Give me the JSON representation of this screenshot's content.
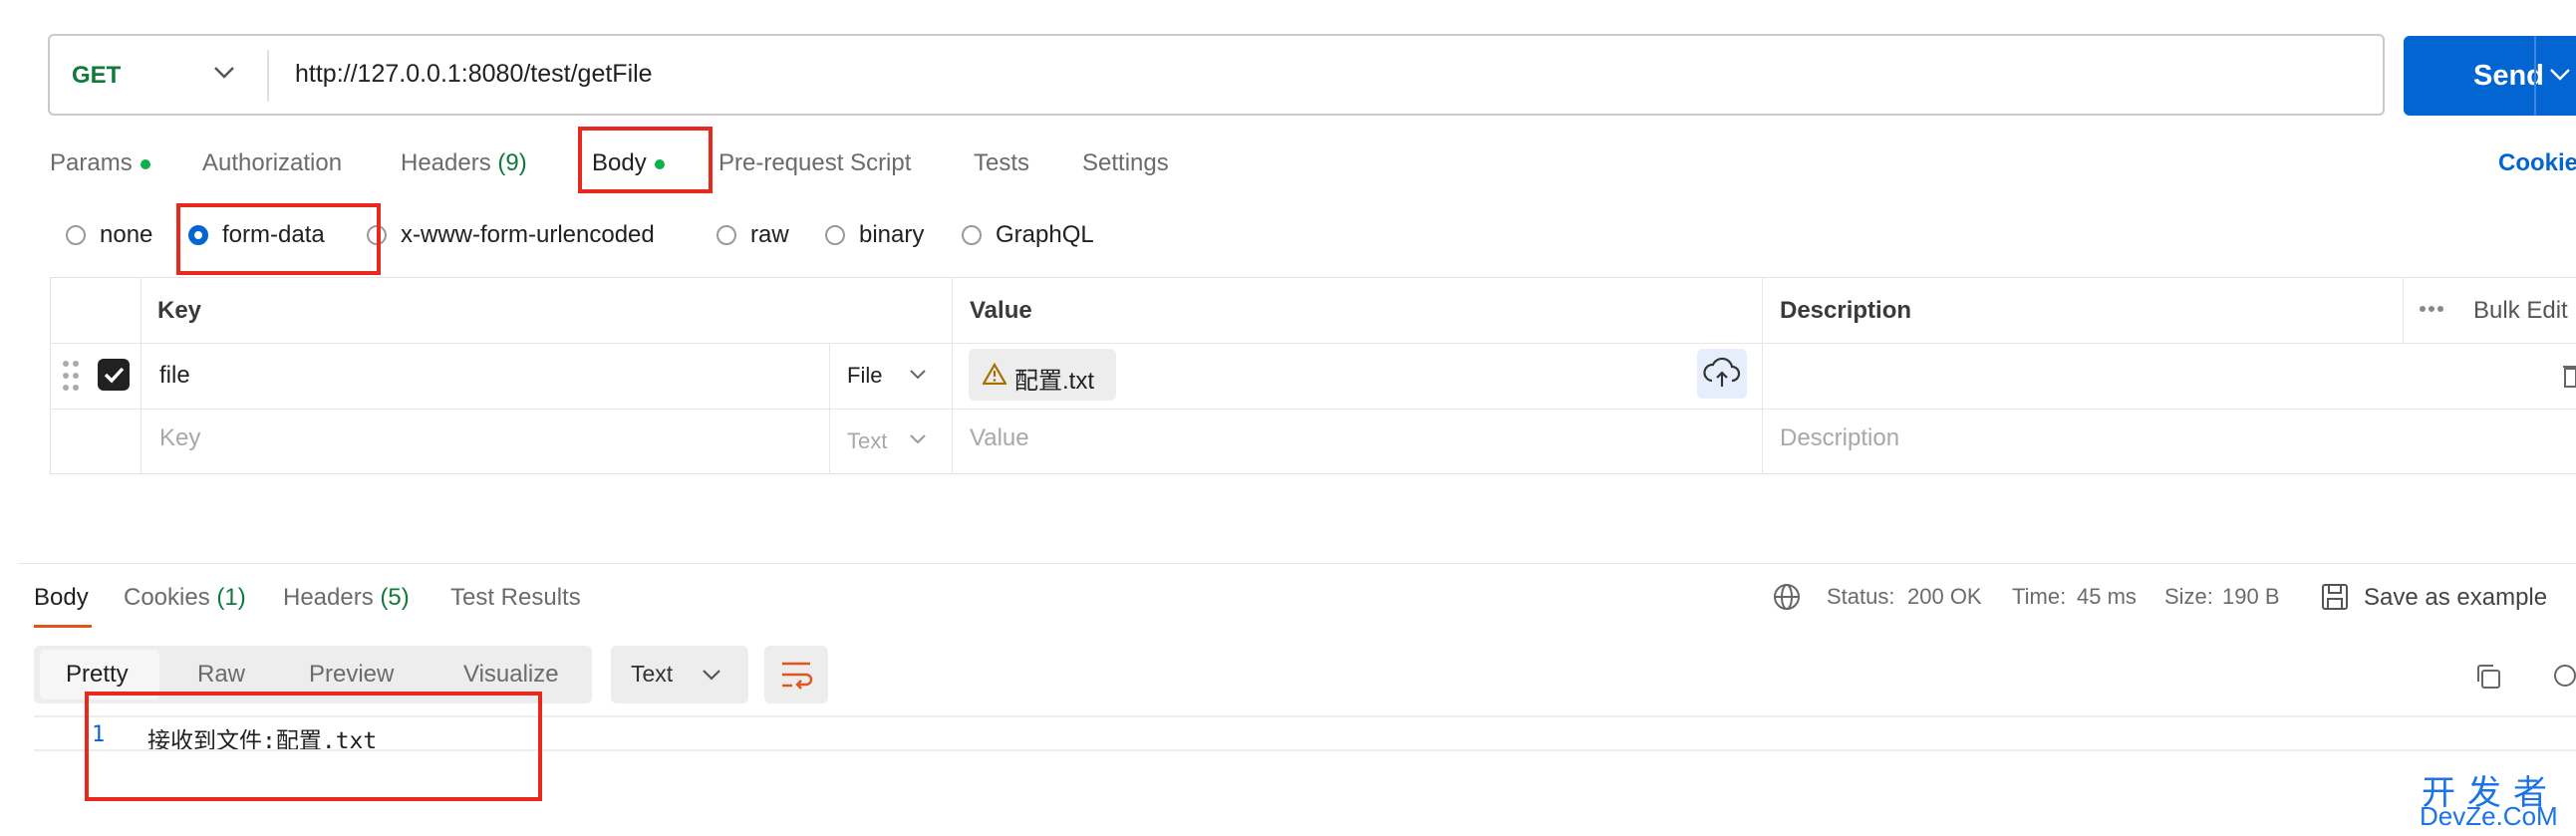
{
  "request": {
    "method": "GET",
    "url": "http://127.0.0.1:8080/test/getFile",
    "send_label": "Send"
  },
  "tabs": {
    "params": "Params",
    "authorization": "Authorization",
    "headers": "Headers",
    "headers_count": "(9)",
    "body": "Body",
    "prerequest": "Pre-request Script",
    "tests": "Tests",
    "settings": "Settings",
    "cookies": "Cookie"
  },
  "body_types": {
    "none": "none",
    "form_data": "form-data",
    "urlencoded": "x-www-form-urlencoded",
    "raw": "raw",
    "binary": "binary",
    "graphql": "GraphQL",
    "selected": "form-data"
  },
  "table": {
    "headers": {
      "key": "Key",
      "value": "Value",
      "description": "Description",
      "bulk_edit": "Bulk Edit"
    },
    "rows": [
      {
        "key": "file",
        "type": "File",
        "value": "配置.txt",
        "checked": true
      }
    ],
    "empty_row": {
      "key_placeholder": "Key",
      "type": "Text",
      "value_placeholder": "Value",
      "description_placeholder": "Description"
    }
  },
  "response": {
    "tabs": {
      "body": "Body",
      "cookies": "Cookies",
      "cookies_count": "(1)",
      "headers": "Headers",
      "headers_count": "(5)",
      "test_results": "Test Results"
    },
    "status_label": "Status:",
    "status_value": "200 OK",
    "time_label": "Time:",
    "time_value": "45 ms",
    "size_label": "Size:",
    "size_value": "190 B",
    "save_example": "Save as example",
    "view_tabs": {
      "pretty": "Pretty",
      "raw": "Raw",
      "preview": "Preview",
      "visualize": "Visualize"
    },
    "format": "Text",
    "lines": [
      {
        "no": "1",
        "text": "接收到文件:配置.txt"
      }
    ]
  },
  "watermark": {
    "top": "开发者",
    "bottom": "DevZe.CoM"
  },
  "colors": {
    "accent": "#0265d2",
    "method_green": "#0f7b3a",
    "annotation_red": "#e8291d",
    "active_tab_underline": "#e2541a"
  }
}
